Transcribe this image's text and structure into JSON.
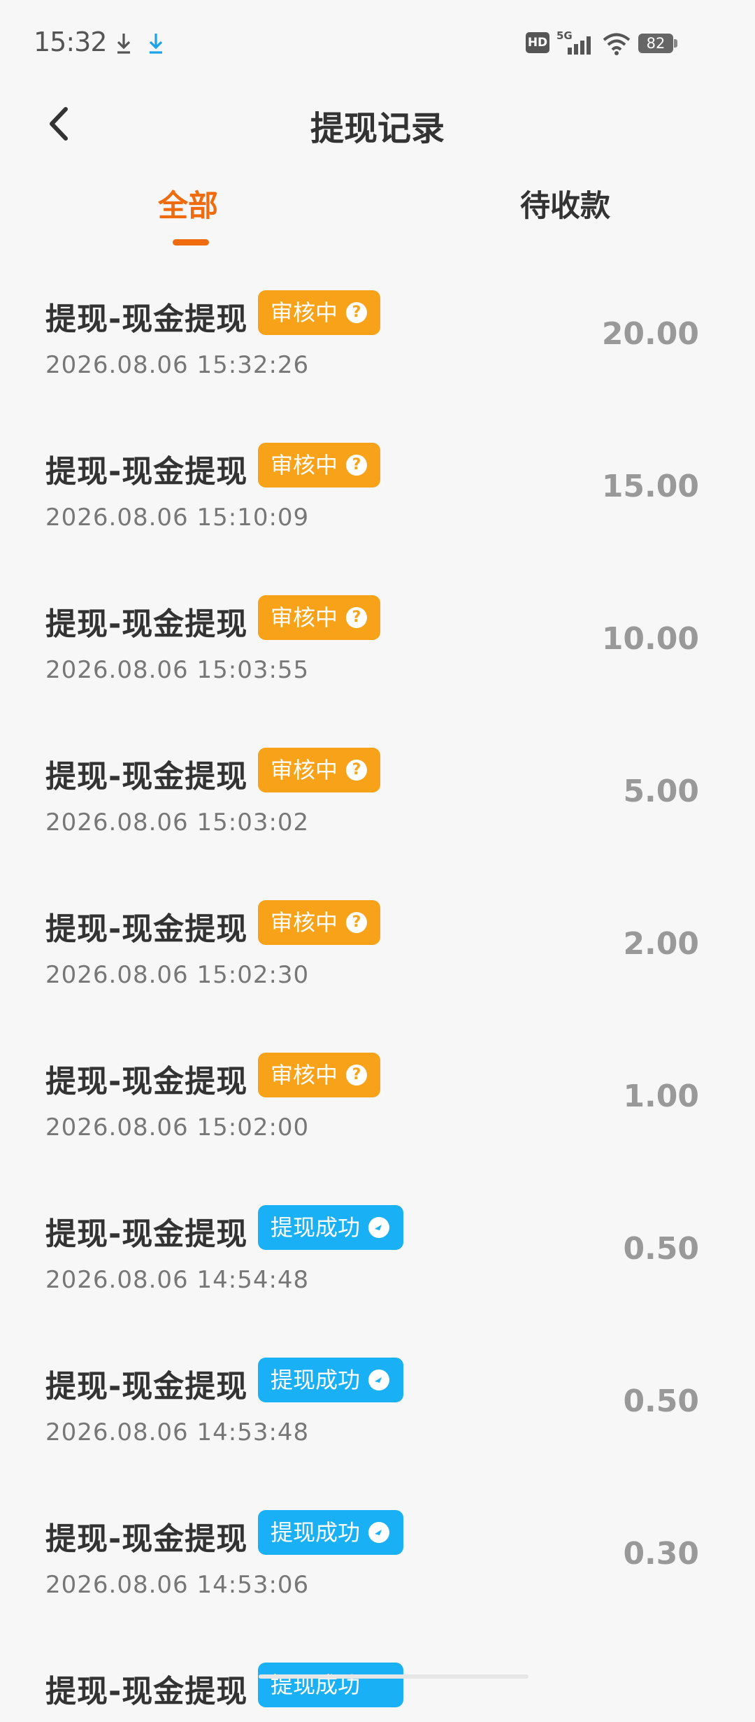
{
  "status_bar": {
    "time": "15:32",
    "hd_label": "HD",
    "network_label": "5G",
    "battery": "82",
    "icons": [
      "download-icon",
      "download-icon",
      "hd-icon",
      "signal-icon",
      "wifi-icon",
      "battery-icon"
    ]
  },
  "header": {
    "title": "提现记录",
    "back_icon": "chevron-left-icon"
  },
  "tabs": [
    {
      "label": "全部",
      "active": true
    },
    {
      "label": "待收款",
      "active": false
    }
  ],
  "colors": {
    "accent": "#f06a0e",
    "review_badge": "#f8a21a",
    "success_badge": "#1ab0f5",
    "amount": "#999999"
  },
  "records": [
    {
      "title": "提现-现金提现",
      "status": "审核中",
      "status_type": "review",
      "time": "2026.08.06 15:32:26",
      "amount": "20.00"
    },
    {
      "title": "提现-现金提现",
      "status": "审核中",
      "status_type": "review",
      "time": "2026.08.06 15:10:09",
      "amount": "15.00"
    },
    {
      "title": "提现-现金提现",
      "status": "审核中",
      "status_type": "review",
      "time": "2026.08.06 15:03:55",
      "amount": "10.00"
    },
    {
      "title": "提现-现金提现",
      "status": "审核中",
      "status_type": "review",
      "time": "2026.08.06 15:03:02",
      "amount": "5.00"
    },
    {
      "title": "提现-现金提现",
      "status": "审核中",
      "status_type": "review",
      "time": "2026.08.06 15:02:30",
      "amount": "2.00"
    },
    {
      "title": "提现-现金提现",
      "status": "审核中",
      "status_type": "review",
      "time": "2026.08.06 15:02:00",
      "amount": "1.00"
    },
    {
      "title": "提现-现金提现",
      "status": "提现成功",
      "status_type": "success",
      "time": "2026.08.06 14:54:48",
      "amount": "0.50"
    },
    {
      "title": "提现-现金提现",
      "status": "提现成功",
      "status_type": "success",
      "time": "2026.08.06 14:53:48",
      "amount": "0.50"
    },
    {
      "title": "提现-现金提现",
      "status": "提现成功",
      "status_type": "success",
      "time": "2026.08.06 14:53:06",
      "amount": "0.30"
    },
    {
      "title": "提现-现金提现",
      "status": "提现成功",
      "status_type": "success",
      "time": "",
      "amount": ""
    }
  ]
}
